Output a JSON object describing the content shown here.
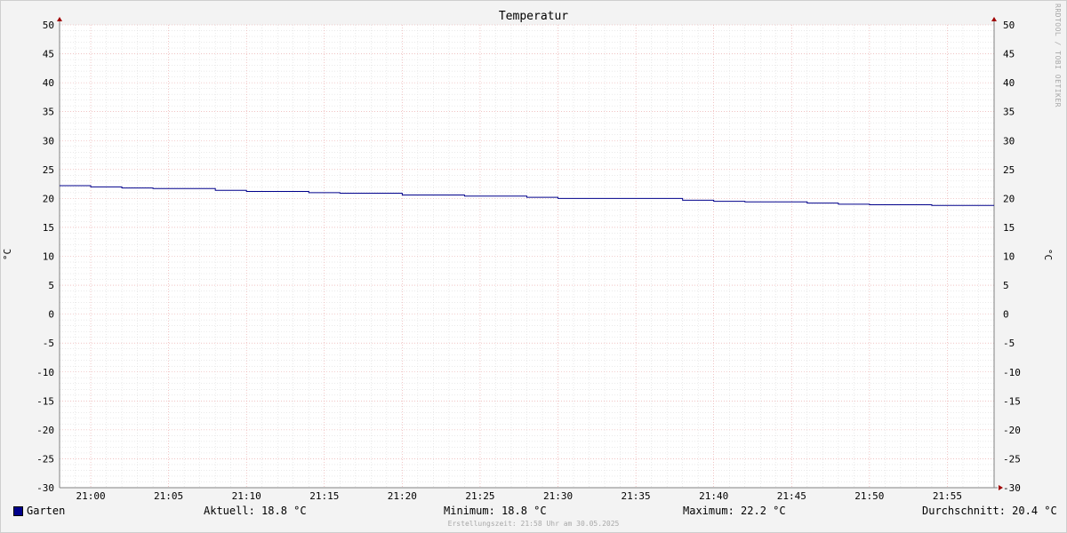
{
  "chart_data": {
    "type": "line",
    "title": "Temperatur",
    "ylabel": "°C",
    "ylabel_right": "°C",
    "ylim": [
      -30,
      50
    ],
    "y_ticks": [
      50,
      45,
      40,
      35,
      30,
      25,
      20,
      15,
      10,
      5,
      0,
      -5,
      -10,
      -15,
      -20,
      -25,
      -30
    ],
    "x_ticks": [
      "21:00",
      "21:05",
      "21:10",
      "21:15",
      "21:20",
      "21:25",
      "21:30",
      "21:35",
      "21:40",
      "21:45",
      "21:50",
      "21:55"
    ],
    "x_range": [
      "20:58",
      "21:58"
    ],
    "grid": true,
    "series": [
      {
        "name": "Garten",
        "color": "#00008b",
        "step": true,
        "x": [
          "20:58",
          "21:00",
          "21:02",
          "21:04",
          "21:06",
          "21:08",
          "21:10",
          "21:12",
          "21:14",
          "21:16",
          "21:18",
          "21:20",
          "21:22",
          "21:24",
          "21:26",
          "21:28",
          "21:30",
          "21:32",
          "21:34",
          "21:36",
          "21:38",
          "21:40",
          "21:42",
          "21:44",
          "21:46",
          "21:48",
          "21:50",
          "21:52",
          "21:54",
          "21:56",
          "21:58"
        ],
        "values": [
          22.2,
          22.0,
          21.8,
          21.7,
          21.7,
          21.4,
          21.2,
          21.2,
          21.0,
          20.9,
          20.9,
          20.6,
          20.6,
          20.4,
          20.4,
          20.2,
          20.0,
          20.0,
          20.0,
          20.0,
          19.7,
          19.5,
          19.4,
          19.4,
          19.2,
          19.0,
          18.9,
          18.9,
          18.8,
          18.8,
          18.8
        ]
      }
    ]
  },
  "legend": {
    "series_name": "Garten",
    "aktuell": "Aktuell: 18.8 °C",
    "minimum": "Minimum: 18.8 °C",
    "maximum": "Maximum: 22.2 °C",
    "durchschnitt": "Durchschnitt: 20.4 °C"
  },
  "watermark": "RRDTOOL / TOBI OETIKER",
  "footer": "Erstellungszeit: 21:58 Uhr am 30.05.2025"
}
